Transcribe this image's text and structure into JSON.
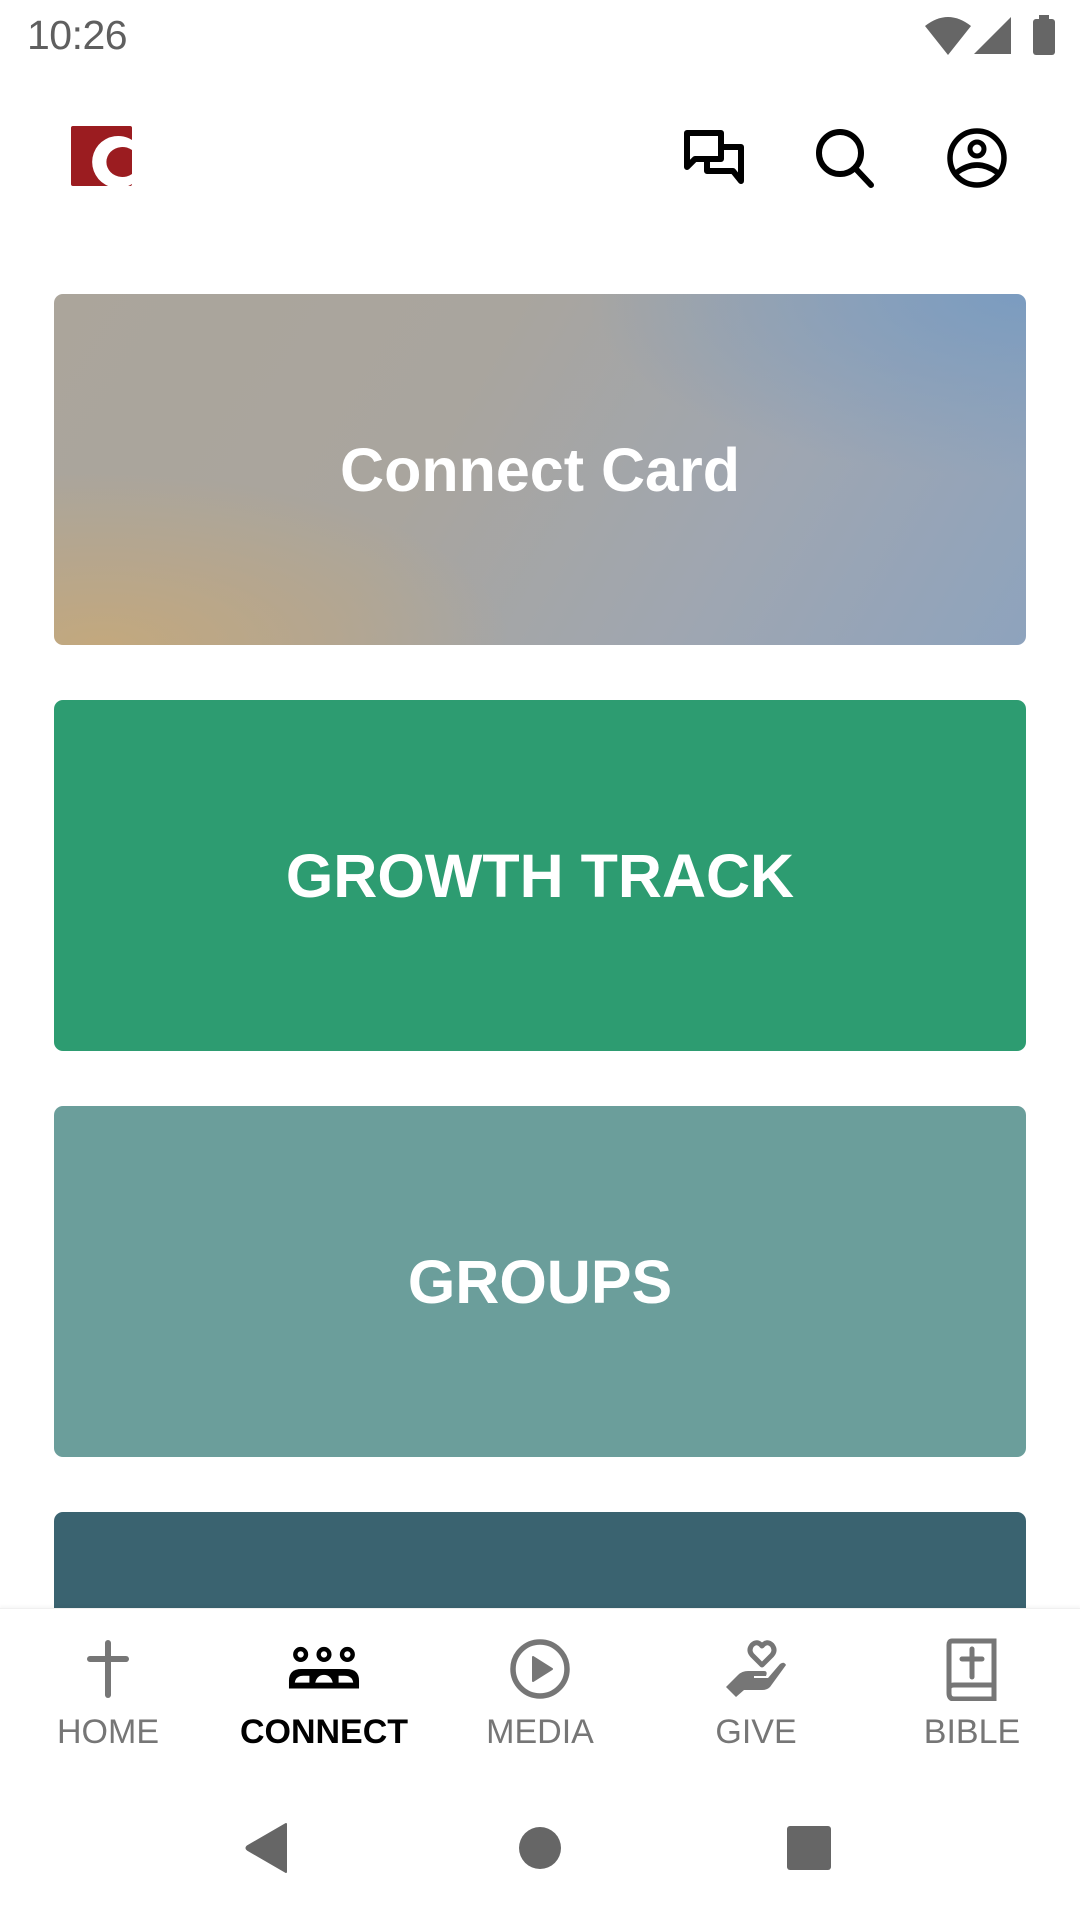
{
  "status_bar": {
    "time": "10:26",
    "icons": [
      "wifi-icon",
      "signal-icon",
      "battery-icon"
    ],
    "icon_color": "#666666"
  },
  "header": {
    "logo": "church-logo",
    "logo_color": "#9b1c20",
    "actions": [
      {
        "name": "messages-button",
        "icon": "chat-icon"
      },
      {
        "name": "search-button",
        "icon": "search-icon"
      },
      {
        "name": "profile-button",
        "icon": "account-circle-icon"
      }
    ]
  },
  "cards": [
    {
      "title": "Connect Card",
      "background": "gradient"
    },
    {
      "title": "GROWTH TRACK",
      "background": "#2d9c71"
    },
    {
      "title": "GROUPS",
      "background": "#6b9e9b"
    },
    {
      "title": "",
      "background": "#3a6370"
    }
  ],
  "bottom_nav": {
    "active_color": "#000000",
    "inactive_color": "#767676",
    "items": [
      {
        "label": "HOME",
        "icon": "cross-icon",
        "active": false
      },
      {
        "label": "CONNECT",
        "icon": "people-group-icon",
        "active": true
      },
      {
        "label": "MEDIA",
        "icon": "play-circle-icon",
        "active": false
      },
      {
        "label": "GIVE",
        "icon": "hand-heart-icon",
        "active": false
      },
      {
        "label": "BIBLE",
        "icon": "bible-icon",
        "active": false
      }
    ]
  },
  "system_nav": {
    "buttons": [
      "back-icon",
      "home-icon",
      "recents-icon"
    ]
  }
}
